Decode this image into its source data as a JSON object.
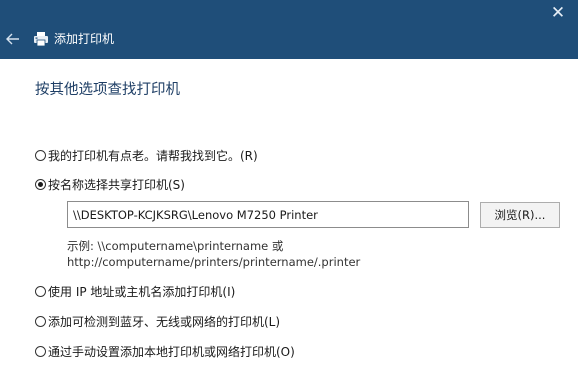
{
  "window": {
    "title": "添加打印机",
    "close_symbol": "✕",
    "icons": {
      "back": "arrow-left-icon",
      "app": "printer-icon",
      "close": "close-icon"
    },
    "colors": {
      "titlebar": "#1f4e79",
      "heading": "#1f3f66"
    }
  },
  "page": {
    "heading": "按其他选项查找打印机",
    "options": [
      {
        "label": "我的打印机有点老。请帮我找到它。(R)",
        "selected": false
      },
      {
        "label": "按名称选择共享打印机(S)",
        "selected": true
      },
      {
        "label": "使用 IP 地址或主机名添加打印机(I)",
        "selected": false
      },
      {
        "label": "添加可检测到蓝牙、无线或网络的打印机(L)",
        "selected": false
      },
      {
        "label": "通过手动设置添加本地打印机或网络打印机(O)",
        "selected": false
      }
    ],
    "shared_printer": {
      "value": "\\\\DESKTOP-KCJKSRG\\Lenovo M7250 Printer",
      "browse_label": "浏览(R)...",
      "example_line1": "示例: \\\\computername\\printername 或",
      "example_line2": "http://computername/printers/printername/.printer"
    }
  }
}
